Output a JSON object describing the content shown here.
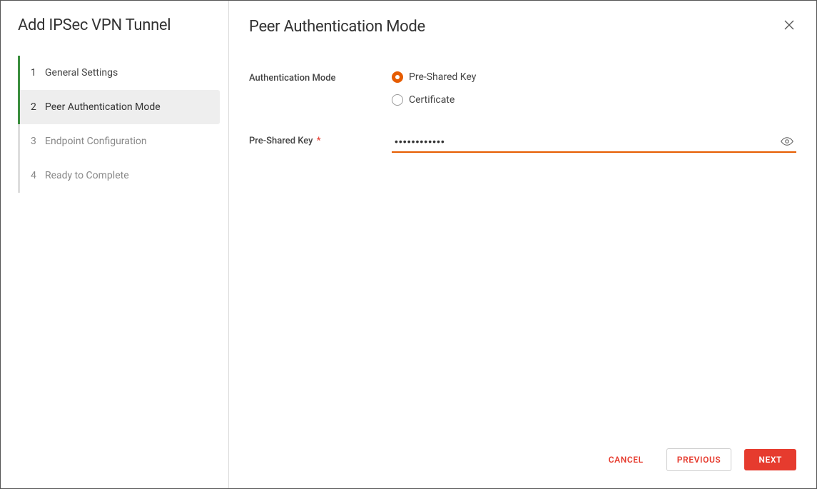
{
  "sidebar": {
    "title": "Add IPSec VPN Tunnel",
    "steps": [
      {
        "num": "1",
        "label": "General Settings",
        "state": "completed"
      },
      {
        "num": "2",
        "label": "Peer Authentication Mode",
        "state": "active"
      },
      {
        "num": "3",
        "label": "Endpoint Configuration",
        "state": "pending"
      },
      {
        "num": "4",
        "label": "Ready to Complete",
        "state": "pending"
      }
    ]
  },
  "main": {
    "title": "Peer Authentication Mode",
    "form": {
      "auth_mode_label": "Authentication Mode",
      "auth_mode_options": {
        "psk": "Pre-Shared Key",
        "cert": "Certificate"
      },
      "auth_mode_selected": "psk",
      "psk_label": "Pre-Shared Key",
      "psk_value": "............"
    }
  },
  "footer": {
    "cancel": "CANCEL",
    "previous": "PREVIOUS",
    "next": "NEXT"
  }
}
